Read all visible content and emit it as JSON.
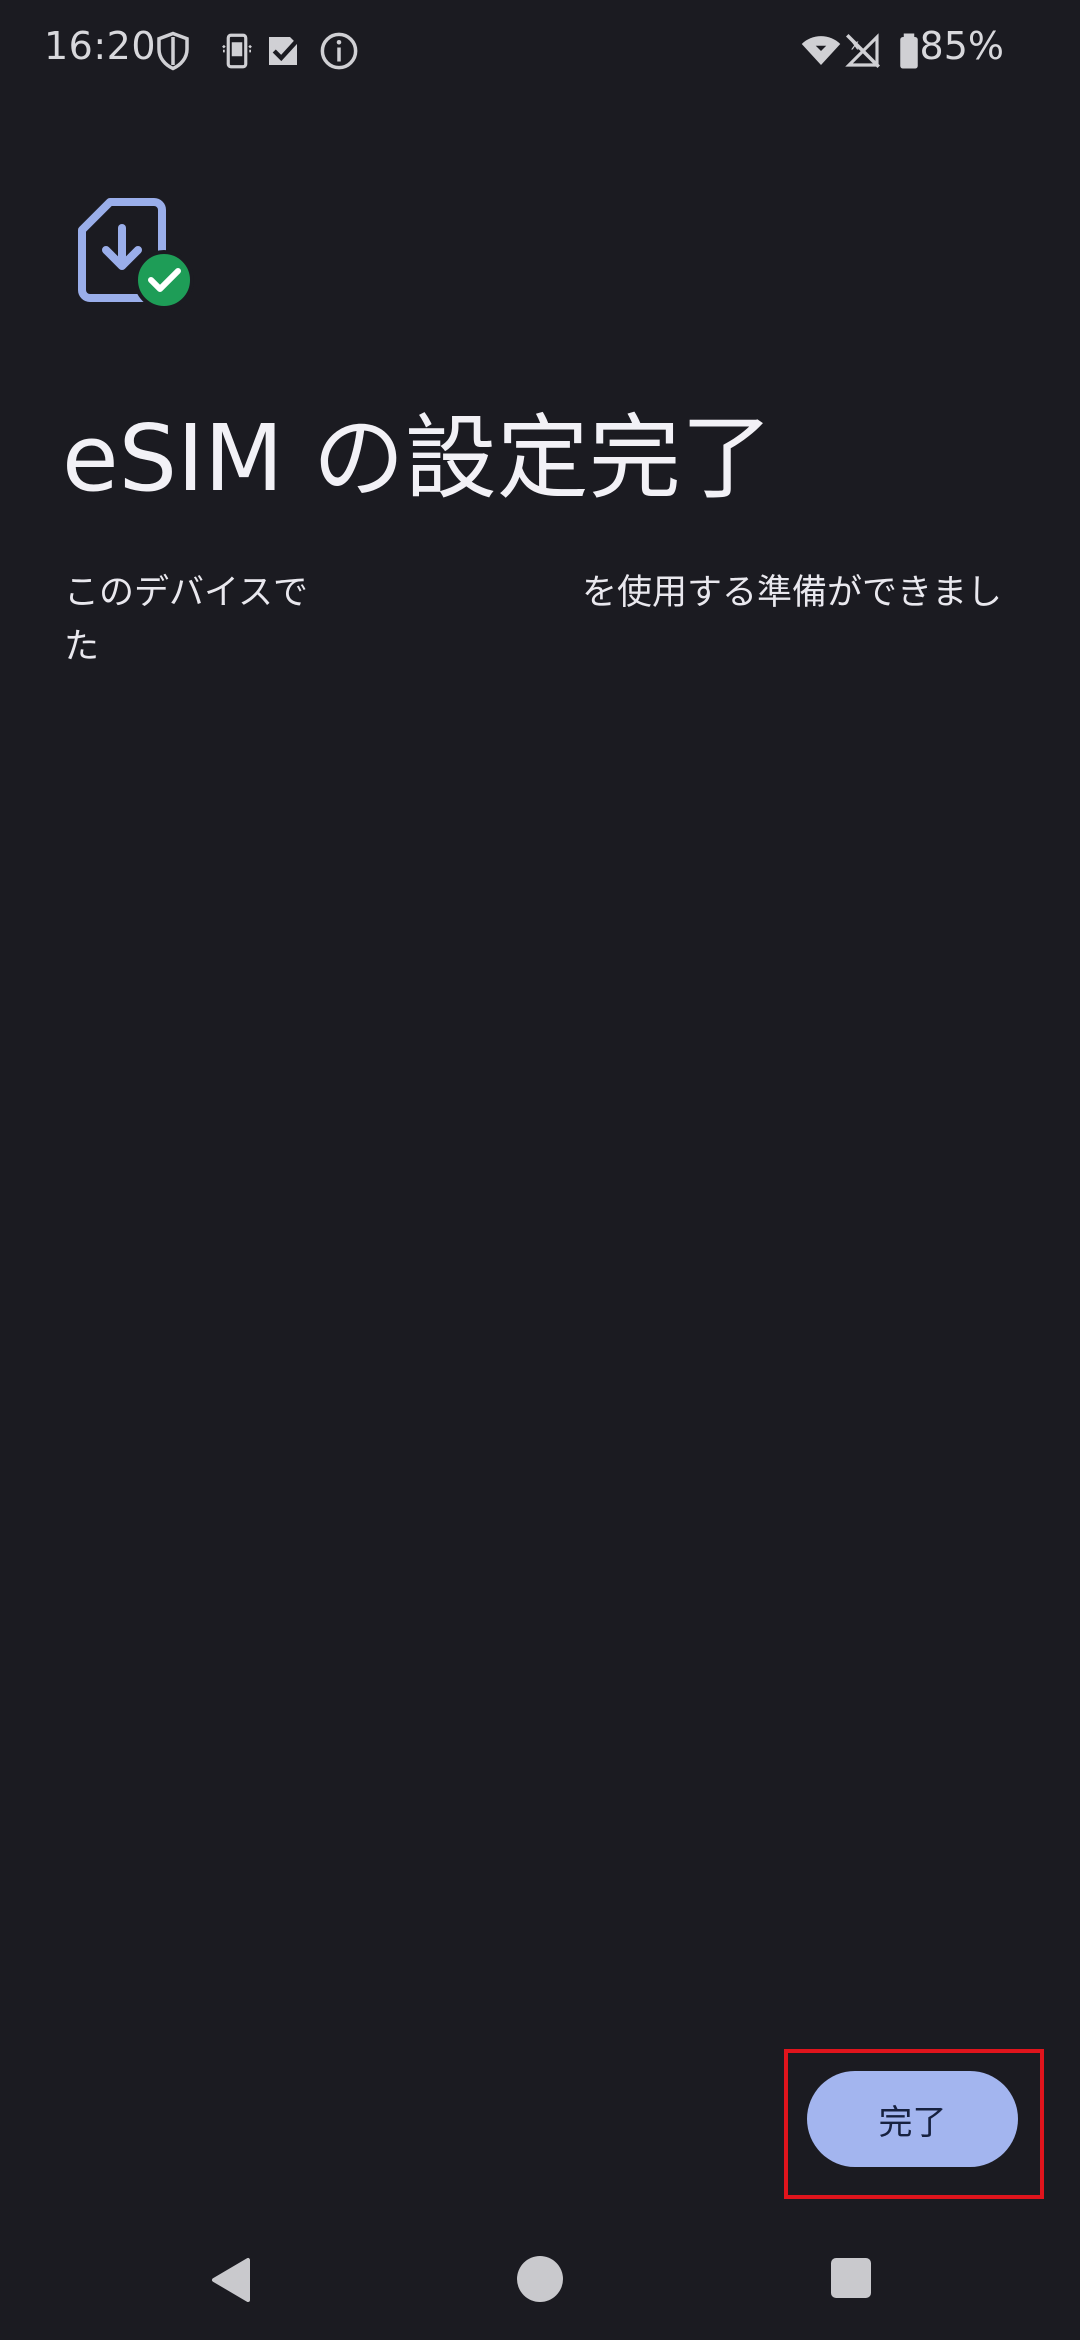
{
  "status_bar": {
    "time": "16:20",
    "icons_left": [
      "shield-icon",
      "phone-sync-icon",
      "checkbox-icon",
      "info-icon"
    ],
    "icons_right": [
      "wifi-icon",
      "signal-off-icon",
      "battery-icon"
    ],
    "battery_percent": "85%"
  },
  "content": {
    "icon": "sim-download-check-icon",
    "title": "eSIM の設定完了",
    "description_part1": "このデバイスで",
    "description_part2": "を使用する準備ができました"
  },
  "actions": {
    "done_label": "完了"
  },
  "navigation": {
    "buttons": [
      "back-icon",
      "home-icon",
      "recents-icon"
    ]
  },
  "colors": {
    "background": "#1b1b21",
    "button": "#a3b5ef",
    "icon_accent": "#9aaeea",
    "check_green": "#1e9d57",
    "highlight": "#e0141c"
  }
}
